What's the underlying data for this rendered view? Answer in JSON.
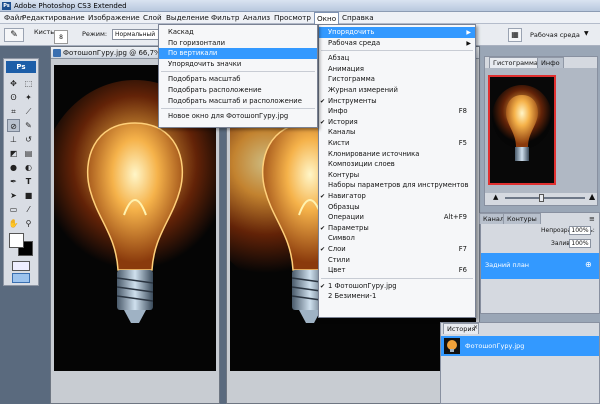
{
  "titlebar": {
    "title": "Adobe Photoshop CS3 Extended",
    "logo": "Ps"
  },
  "menubar": {
    "items": [
      "Файл",
      "Редактирование",
      "Изображение",
      "Слой",
      "Выделение",
      "Фильтр",
      "Анализ",
      "Просмотр",
      "Окно",
      "Справка"
    ],
    "active": "Окно"
  },
  "options": {
    "brush_label": "Кисть:",
    "brush_size": "8",
    "mode_label": "Режим:",
    "mode_value": "Нормальный",
    "workspace_label": "Рабочая среда"
  },
  "toolbox": {
    "logo": "Ps"
  },
  "documents": [
    {
      "tab": "ФотошопГуру.jpg @ 66,7% (R..."
    }
  ],
  "menu_window": {
    "items": [
      {
        "label": "Упорядочить",
        "submenu": true,
        "highlighted": true
      },
      {
        "label": "Рабочая среда",
        "submenu": true
      },
      {
        "sep": true
      },
      {
        "label": "Абзац"
      },
      {
        "label": "Анимация"
      },
      {
        "label": "Гистограмма"
      },
      {
        "label": "Журнал измерений"
      },
      {
        "label": "Инструменты",
        "checked": true
      },
      {
        "label": "Инфо",
        "shortcut": "F8"
      },
      {
        "label": "История",
        "checked": true
      },
      {
        "label": "Каналы"
      },
      {
        "label": "Кисти",
        "shortcut": "F5"
      },
      {
        "label": "Клонирование источника"
      },
      {
        "label": "Композиции слоев"
      },
      {
        "label": "Контуры"
      },
      {
        "label": "Наборы параметров для инструментов"
      },
      {
        "label": "Навигатор",
        "checked": true
      },
      {
        "label": "Образцы"
      },
      {
        "label": "Операции",
        "shortcut": "Alt+F9"
      },
      {
        "label": "Параметры",
        "checked": true
      },
      {
        "label": "Символ"
      },
      {
        "label": "Слои",
        "checked": true,
        "shortcut": "F7"
      },
      {
        "label": "Стили"
      },
      {
        "label": "Цвет",
        "shortcut": "F6"
      },
      {
        "sep": true
      },
      {
        "label": "1 ФотошопГуру.jpg",
        "checked": true
      },
      {
        "label": "2 Безимени-1"
      }
    ]
  },
  "menu_arrange": {
    "items": [
      {
        "label": "Каскад"
      },
      {
        "label": "По горизонтали"
      },
      {
        "label": "По вертикали",
        "highlighted": true
      },
      {
        "label": "Упорядочить значки"
      },
      {
        "sep": true
      },
      {
        "label": "Подобрать масштаб"
      },
      {
        "label": "Подобрать расположение"
      },
      {
        "label": "Подобрать масштаб и расположение"
      },
      {
        "sep": true
      },
      {
        "label": "Новое окно для ФотошопГуру.jpg"
      }
    ]
  },
  "panels": {
    "navigator_tabs": [
      "Гистограмма",
      "Инфо"
    ],
    "layers_tabs": [
      "Каналы",
      "Контуры"
    ],
    "opacity_label": "Непрозрачность:",
    "opacity_value": "100%",
    "fill_label": "Заливка:",
    "fill_value": "100%",
    "layer_name": "Задний план",
    "history_tab": "История",
    "history_item": "ФотошопГуру.jpg"
  },
  "colors": {
    "highlight": "#3399ff",
    "menu_bg": "#f6f7f9",
    "chrome": "#5a6a7e"
  }
}
